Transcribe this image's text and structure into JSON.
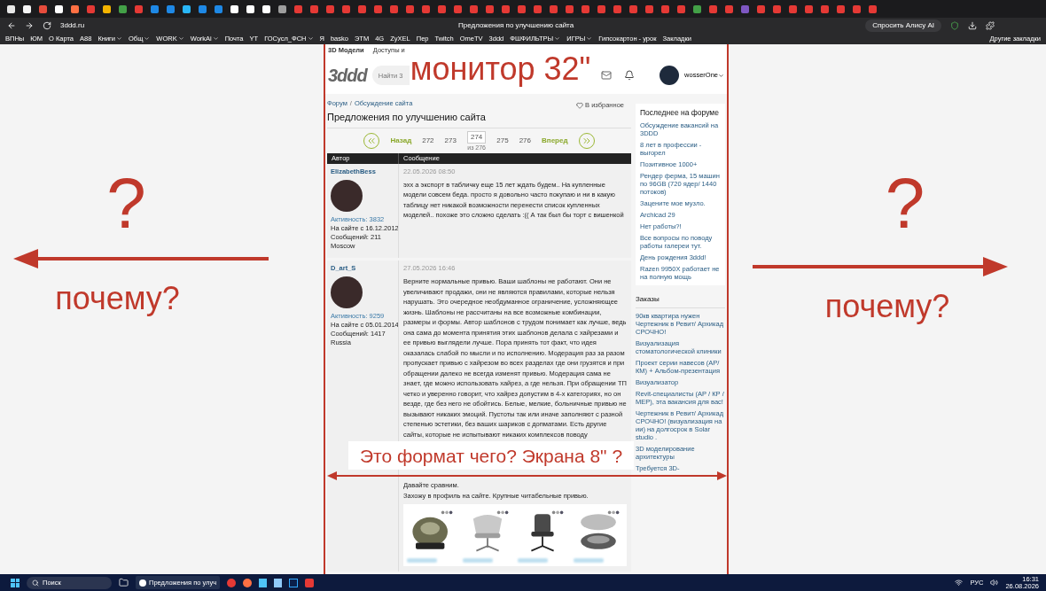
{
  "browser": {
    "tabs": [
      {
        "color": "#e8e8e8"
      },
      {
        "color": "#f5f5f5"
      },
      {
        "color": "#e74c3c"
      },
      {
        "color": "#ffffff"
      },
      {
        "color": "#ff7043"
      },
      {
        "color": "#e53935"
      },
      {
        "color": "#f4b400"
      },
      {
        "color": "#43a047"
      },
      {
        "color": "#e53935"
      },
      {
        "color": "#1e88e5"
      },
      {
        "color": "#1e88e5"
      },
      {
        "color": "#29b6f6"
      },
      {
        "color": "#1e88e5"
      },
      {
        "color": "#1e88e5"
      },
      {
        "color": "#ffffff"
      },
      {
        "color": "#ffffff"
      },
      {
        "color": "#ffffff"
      },
      {
        "color": "#9e9e9e"
      },
      {
        "color": "#e53935"
      },
      {
        "color": "#e53935"
      },
      {
        "color": "#e53935"
      },
      {
        "color": "#e53935"
      },
      {
        "color": "#e53935"
      },
      {
        "color": "#e53935"
      },
      {
        "color": "#e53935"
      },
      {
        "color": "#e53935"
      },
      {
        "color": "#e53935"
      },
      {
        "color": "#e53935"
      },
      {
        "color": "#e53935"
      },
      {
        "color": "#e53935"
      },
      {
        "color": "#e53935"
      },
      {
        "color": "#e53935"
      },
      {
        "color": "#e53935"
      },
      {
        "color": "#e53935"
      },
      {
        "color": "#e53935"
      },
      {
        "color": "#e53935"
      },
      {
        "color": "#e53935"
      },
      {
        "color": "#e53935"
      },
      {
        "color": "#e53935"
      },
      {
        "color": "#e53935"
      },
      {
        "color": "#e53935"
      },
      {
        "color": "#e53935"
      },
      {
        "color": "#e53935"
      },
      {
        "color": "#43a047"
      },
      {
        "color": "#e53935"
      },
      {
        "color": "#e53935"
      },
      {
        "color": "#7e57c2"
      },
      {
        "color": "#e53935"
      },
      {
        "color": "#e53935"
      },
      {
        "color": "#e53935"
      },
      {
        "color": "#e53935"
      },
      {
        "color": "#e53935"
      },
      {
        "color": "#e53935"
      },
      {
        "color": "#e53935"
      },
      {
        "color": "#e53935"
      }
    ],
    "url": "3ddd.ru",
    "page_title": "Предложения по улучшению сайта",
    "ai_button": "Спросить Алису AI",
    "bookmarks": [
      {
        "label": "ВПНы",
        "menu": false
      },
      {
        "label": "ЮМ",
        "menu": false
      },
      {
        "label": "О Карта",
        "menu": false
      },
      {
        "label": "А88",
        "menu": false
      },
      {
        "label": "Книги",
        "menu": true
      },
      {
        "label": "Общ",
        "menu": true
      },
      {
        "label": "WORK",
        "menu": true
      },
      {
        "label": "WorkAi",
        "menu": true
      },
      {
        "label": "Почта",
        "menu": false
      },
      {
        "label": "YT",
        "menu": false
      },
      {
        "label": "ГОСусл_ФСН",
        "menu": true
      },
      {
        "label": "Я",
        "menu": false
      },
      {
        "label": "basko",
        "menu": false
      },
      {
        "label": "ЭТМ",
        "menu": false
      },
      {
        "label": "4G",
        "menu": false
      },
      {
        "label": "ZyXEL",
        "menu": false
      },
      {
        "label": "Пер",
        "menu": false
      },
      {
        "label": "Twitch",
        "menu": false
      },
      {
        "label": "OmeTV",
        "menu": false
      },
      {
        "label": "3ddd",
        "menu": false
      },
      {
        "label": "ФШФИЛЬТРЫ",
        "menu": true
      },
      {
        "label": "ИГРЫ",
        "menu": true
      },
      {
        "label": "Гипсокартон - урок",
        "menu": false
      },
      {
        "label": "Закладки",
        "menu": false
      }
    ],
    "other_bookmarks": "Другие закладки"
  },
  "site": {
    "nav": [
      "3D Модели",
      "Доступы и"
    ],
    "logo": "3ddd",
    "search": {
      "placeholder": "Найти 3"
    },
    "username": "wosserOne",
    "breadcrumb": {
      "items": [
        "Форум",
        "Обсуждение сайта"
      ],
      "separator": "/"
    },
    "favorite": "В избранное",
    "title": "Предложения по улучшению сайта",
    "pagination": {
      "prev": "Назад",
      "next": "Вперед",
      "pages": [
        {
          "label": "272",
          "selected": false
        },
        {
          "label": "273",
          "selected": false
        },
        {
          "label": "274",
          "selected": true
        },
        {
          "label": "275",
          "selected": false
        },
        {
          "label": "276",
          "selected": false
        }
      ],
      "total": "из 276"
    },
    "table": {
      "columns": [
        "Автор",
        "Сообщение"
      ],
      "posts": [
        {
          "author": "ElizabethBess",
          "stats": [
            "Активность: 3832",
            "На сайте с 16.12.2012",
            "Сообщений: 211",
            "Moscow"
          ],
          "date": "22.05.2026 08:50",
          "paragraphs": [
            "эхх а экспорт в табличку еще 15 лет ждать будем.. На купленные модели совсем беда. просто я довольно часто покупаю и ни в какую таблицу нет никакой возможности перенести список купленных моделей.. похоже это сложно сделать :(( А так был бы торт с вишенкой"
          ]
        },
        {
          "author": "D_art_S",
          "stats": [
            "Активность: 9259",
            "На сайте с 05.01.2014",
            "Сообщений: 1417",
            "Russia"
          ],
          "date": "27.05.2026 16:46",
          "paragraphs": [
            "Верните нормальные привью. Ваши шаблоны не работают. Они не увеличивают продажи, они не являются правилами, которые нельзя нарушать. Это очередное необдуманное ограничение, усложняющее  жизнь. Шаблоны не рассчитаны на все возможные комбинации, размеры и формы. Автор шаблонов с трудом понимает как лучше, ведь она сама до момента принятия этих шаблонов делала с хайрезами и ее привью выглядели лучше. Пора принять тот факт, что идея оказалась слабой по мысли и по исполнению. Модерация раз за разом пропускает привью с хайрезом во всех разделах где они грузятся и при обращении далеко не всегда изменят привью. Модерация сама не знает, где можно использовать хайрез, а где нельзя. При обращении ТП четко и уверенно говорит, что хайрез допустим в 4-х категориях, но он везде, где без него не обойтись. Белые, мелкие, больничные привью не вызывают никаких эмоций. Пустоты так или иначе заполняют с разной степенью эстетики, без ваших шариков с допматами. Есть другие сайты, которые не испытывают никаких комплексов поводу",
            "Давайте сравним.",
            "Захожу в профиль на сайте. Крупные  читабельные привью."
          ],
          "images": [
            {
              "kind": "picture"
            },
            {
              "kind": "picture"
            },
            {
              "kind": "picture"
            },
            {
              "kind": "picture"
            }
          ]
        }
      ]
    },
    "sidebar": {
      "latest_title": "Последнее на форуме",
      "latest": [
        "Обсуждение вакансий на 3DDD",
        "8 лет в профессии - выгорел",
        "Позитивное 1000+",
        "Рендер ферма, 15 машин по 96GB (720 ядер/ 1440 потоков)",
        "Зацените мое музло.",
        "Archicad 29",
        "Нет работы?!",
        "Все вопросы по поводу работы галереи тут.",
        "День рождения 3ddd!",
        "Razen 9950X работает не на полную мощь"
      ],
      "orders_title": "Заказы",
      "orders": [
        "90кв квартира нужен Чертежник в Ревит/ Архикад СРОЧНО!",
        "Визуализация стоматологической клиники",
        "Проект серии навесов (АР/КМ) + Альбом-презентация",
        "Визуализатор",
        "Revit-специалисты (АР / КР / МЕР), эта вакансия для вас!",
        "Чертежник в Ревит/ Архикад СРОЧНО! (визуализация на ии) на долгосрок в Solar studio .",
        "3D моделирование архитектуры",
        "Требуется 3D-"
      ]
    }
  },
  "annotations": {
    "top": "монитор 32\"",
    "left_question": "?",
    "left_why": "почему?",
    "right_question": "?",
    "right_why": "почему?",
    "bottom": "Это формат чего? Экрана  8\" ?"
  },
  "taskbar": {
    "search": "Поиск",
    "active_app": "Предложения по улуч",
    "language": "РУС",
    "time": "16:31",
    "date": "26.08.2026"
  }
}
